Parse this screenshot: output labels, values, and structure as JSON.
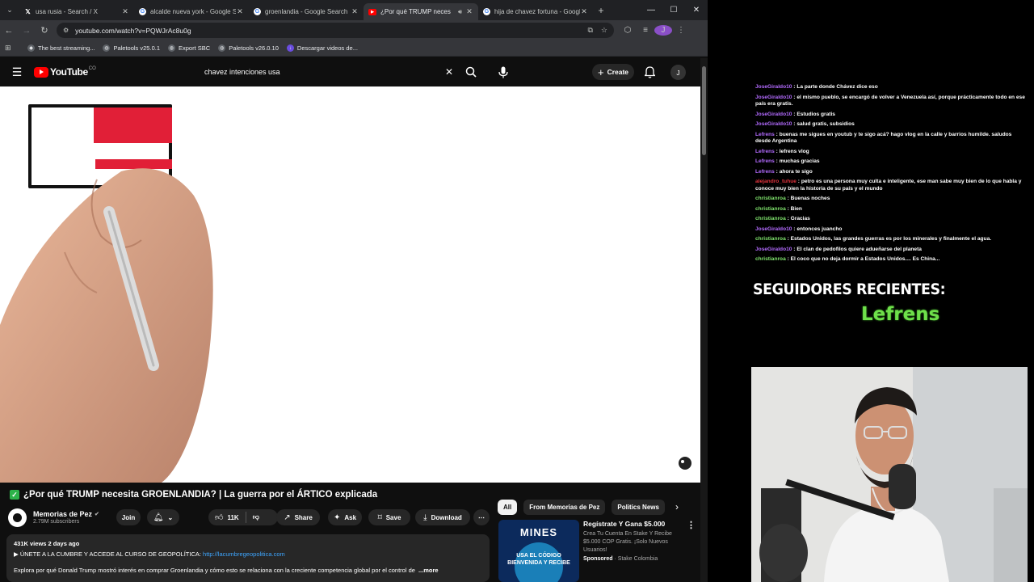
{
  "browser": {
    "tabs": [
      {
        "title": "usa rusia - Search / X",
        "favicon": "x-icon",
        "active": false
      },
      {
        "title": "alcalde nueva york - Google Se",
        "favicon": "google-icon",
        "active": false
      },
      {
        "title": "groenlandia - Google Search",
        "favicon": "google-icon",
        "active": false
      },
      {
        "title": "¿Por qué TRUMP neces",
        "favicon": "youtube-icon",
        "active": true
      },
      {
        "title": "hija de chavez fortuna - Googl",
        "favicon": "google-icon",
        "active": false
      }
    ],
    "url": "youtube.com/watch?v=PQWJrAc8u0g",
    "profile_initial": "J",
    "bookmarks": [
      {
        "label": "The best streaming..."
      },
      {
        "label": "Paletools v25.0.1"
      },
      {
        "label": "Export SBC"
      },
      {
        "label": "Paletools v26.0.10"
      },
      {
        "label": "Descargar videos de..."
      }
    ]
  },
  "youtube": {
    "logo_text": "YouTube",
    "logo_country": "CO",
    "search_query": "chavez intenciones usa",
    "create_label": "Create",
    "avatar_initial": "J",
    "video": {
      "title": "¿Por qué TRUMP necesita GROENLANDIA? | La guerra por el ÁRTICO explicada"
    },
    "channel": {
      "name": "Memorias de Pez",
      "subscribers": "2.79M subscribers",
      "join_label": "Join"
    },
    "actions": {
      "likes": "11K",
      "share": "Share",
      "ask": "Ask",
      "save": "Save",
      "download": "Download"
    },
    "description": {
      "stats": "431K views  2 days ago",
      "line1_prefix": "▶ ÚNETE A LA CUMBRE Y ACCEDE AL CURSO DE GEOPOLÍTICA: ",
      "line1_link": "http://lacumbregeopolitica.com",
      "line2": "Explora por qué Donald Trump mostró interés en comprar Groenlandia y cómo esto se relaciona con la creciente competencia global por el control de",
      "more": "...more"
    },
    "chips": [
      "All",
      "From Memorias de Pez",
      "Politics News"
    ],
    "ad": {
      "thumb_title": "MINES",
      "thumb_tagline": "USA EL CÓDIGO BIENVENIDA Y RECIBE",
      "title": "Regístrate Y Gana $5.000",
      "description": "Crea Tu Cuenta En Stake Y Recibe $5.000 COP Gratis. ¡Solo Nuevos Usuarios!",
      "sponsored": "Sponsored",
      "advertiser": "Stake Colombia"
    }
  },
  "overlay": {
    "chat": [
      {
        "user": "JoseGiraldo10",
        "color": "#b36bff",
        "text": "La parte donde Chávez dice eso"
      },
      {
        "user": "JoseGiraldo10",
        "color": "#b36bff",
        "text": "el mismo pueblo, se encargó de volver a Venezuela así, porque prácticamente todo en ese país era gratis."
      },
      {
        "user": "JoseGiraldo10",
        "color": "#b36bff",
        "text": "Estudios gratis"
      },
      {
        "user": "JoseGiraldo10",
        "color": "#b36bff",
        "text": "salud gratis, subsidios"
      },
      {
        "user": "Lefrens",
        "color": "#b36bff",
        "text": "buenas me sigues en youtub y te sigo acá? hago vlog en la calle y barrios humilde. saludos desde Argentina"
      },
      {
        "user": "Lefrens",
        "color": "#b36bff",
        "text": "lefrens vlog"
      },
      {
        "user": "Lefrens",
        "color": "#b36bff",
        "text": "muchas gracias"
      },
      {
        "user": "Lefrens",
        "color": "#b36bff",
        "text": "ahora te sigo"
      },
      {
        "user": "alejandro_tuhue",
        "color": "#e0333d",
        "text": "petro es una persona muy culta e inteligente, ese man sabe muy bien de lo que habla y conoce muy bien la historia de su país y el mundo"
      },
      {
        "user": "christianroa",
        "color": "#7fe36c",
        "text": "Buenas noches"
      },
      {
        "user": "christianroa",
        "color": "#7fe36c",
        "text": "Bien"
      },
      {
        "user": "christianroa",
        "color": "#7fe36c",
        "text": "Gracias"
      },
      {
        "user": "JoseGiraldo10",
        "color": "#b36bff",
        "text": "entonces juancho"
      },
      {
        "user": "christianroa",
        "color": "#7fe36c",
        "text": "Estados Unidos, las grandes guerras es por los minerales y finalmente el agua."
      },
      {
        "user": "JoseGiraldo10",
        "color": "#b36bff",
        "text": "El clan de pedofilos quiere adueñarse del planeta"
      },
      {
        "user": "christianroa",
        "color": "#7fe36c",
        "text": "El coco que no deja dormir a Estados Unidos.... Es China..."
      }
    ],
    "followers_title": "SEGUIDORES RECIENTES:",
    "followers_name": "Lefrens"
  }
}
